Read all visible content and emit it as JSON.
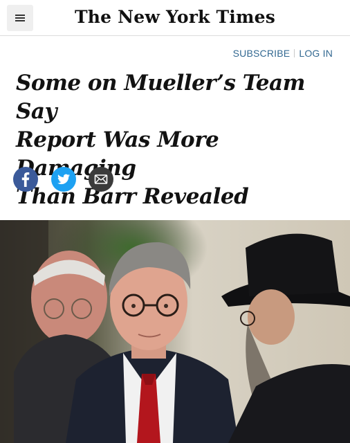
{
  "masthead": {
    "logo": "The New York Times"
  },
  "account": {
    "subscribe": "SUBSCRIBE",
    "login": "LOG IN"
  },
  "article": {
    "headline_lines": [
      "Some on Mueller’s Team Say",
      "Report Was More Damaging",
      "Than Barr Revealed"
    ]
  },
  "share": {
    "icons": [
      "facebook-icon",
      "twitter-icon",
      "email-icon"
    ],
    "colors": {
      "facebook": "#3b5a9a",
      "twitter": "#1da1f2",
      "email": "#3b3b3b"
    }
  },
  "colors": {
    "link": "#326891",
    "text": "#121212"
  }
}
